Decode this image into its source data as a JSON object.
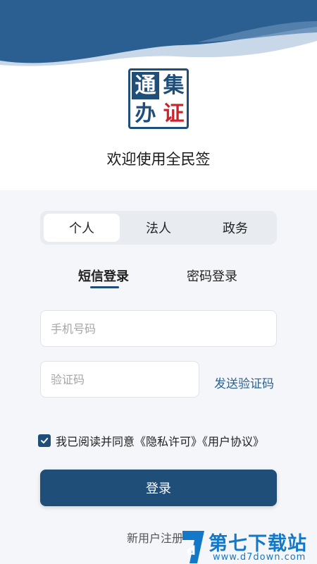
{
  "header": {
    "seal_chars": [
      "通",
      "集",
      "办",
      "证"
    ],
    "welcome": "欢迎使用全民签"
  },
  "account_tabs": [
    {
      "label": "个人",
      "active": true
    },
    {
      "label": "法人",
      "active": false
    },
    {
      "label": "政务",
      "active": false
    }
  ],
  "login_tabs": [
    {
      "label": "短信登录",
      "active": true
    },
    {
      "label": "密码登录",
      "active": false
    }
  ],
  "form": {
    "phone_placeholder": "手机号码",
    "code_placeholder": "验证码",
    "send_code": "发送验证码",
    "agree_checked": true,
    "agree_text": "我已阅读并同意《隐私许可》《用户协议》",
    "login_button": "登录",
    "register_link": "新用户注册"
  },
  "watermark": {
    "title": "第七下载站",
    "url": "www.d7down.com"
  },
  "colors": {
    "primary": "#1f4e79",
    "link": "#2a6496",
    "seal_red": "#c8242b",
    "background": "#f4f6f9",
    "watermark": "#1478c8"
  },
  "icons": [
    "check-icon",
    "watermark-logo-icon"
  ]
}
